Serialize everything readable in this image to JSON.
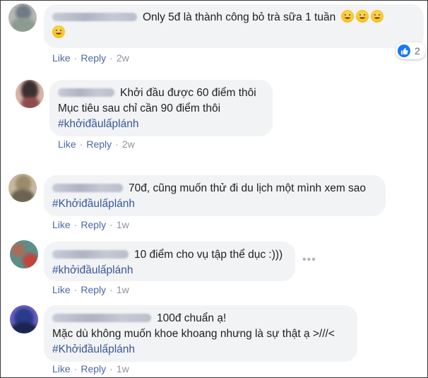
{
  "comments": [
    {
      "text": "Only 5đ là thành công bỏ trà sữa 1 tuần",
      "emoji_count": 4,
      "actions": {
        "like": "Like",
        "reply": "Reply",
        "time": "2w"
      },
      "reaction_count": "2",
      "avatar_colors": [
        "#6f7a86",
        "#b0b6a9",
        "#8c9a8f"
      ]
    },
    {
      "line1": "Khởi đầu được 60 điểm thôi",
      "line2": "Mục tiêu sau chỉ cần 90 điểm thôi",
      "hashtag": "#khởiđầulấplánh",
      "actions": {
        "like": "Like",
        "reply": "Reply",
        "time": "2w"
      },
      "avatar_colors": [
        "#3a2f2f",
        "#d9b3a8",
        "#8e4b4b"
      ]
    },
    {
      "line1": "70đ, cũng muốn thử đi du lịch một mình xem sao",
      "hashtag": "#Khởiđầulấplánh",
      "actions": {
        "like": "Like",
        "reply": "Reply",
        "time": "1w"
      },
      "avatar_colors": [
        "#9b8a6b",
        "#c7b8a0",
        "#6c6352"
      ]
    },
    {
      "line1": "10 điểm cho vụ tập thể dục :)))",
      "hashtag": "#khởiđầulấplánh",
      "actions": {
        "like": "Like",
        "reply": "Reply",
        "time": "1w"
      },
      "more": "•••",
      "avatar_colors": [
        "#a86d5a",
        "#5a8f8a",
        "#c0453c"
      ]
    },
    {
      "line1": "100đ chuẩn ạ!",
      "line2": "Mặc dù không muốn khoe khoang nhưng là sự thật ạ >///<",
      "hashtag": "#Khởiđầulấplánh",
      "actions": {
        "like": "Like",
        "reply": "Reply",
        "time": "1w"
      },
      "avatar_colors": [
        "#2b3a8c",
        "#6a5fc1",
        "#1d2450"
      ]
    }
  ],
  "colors": {
    "bubble": "#f2f3f5",
    "link": "#4b67a1",
    "hashtag": "#385898",
    "meta": "#8d949e",
    "like_badge": "#1877f2"
  }
}
